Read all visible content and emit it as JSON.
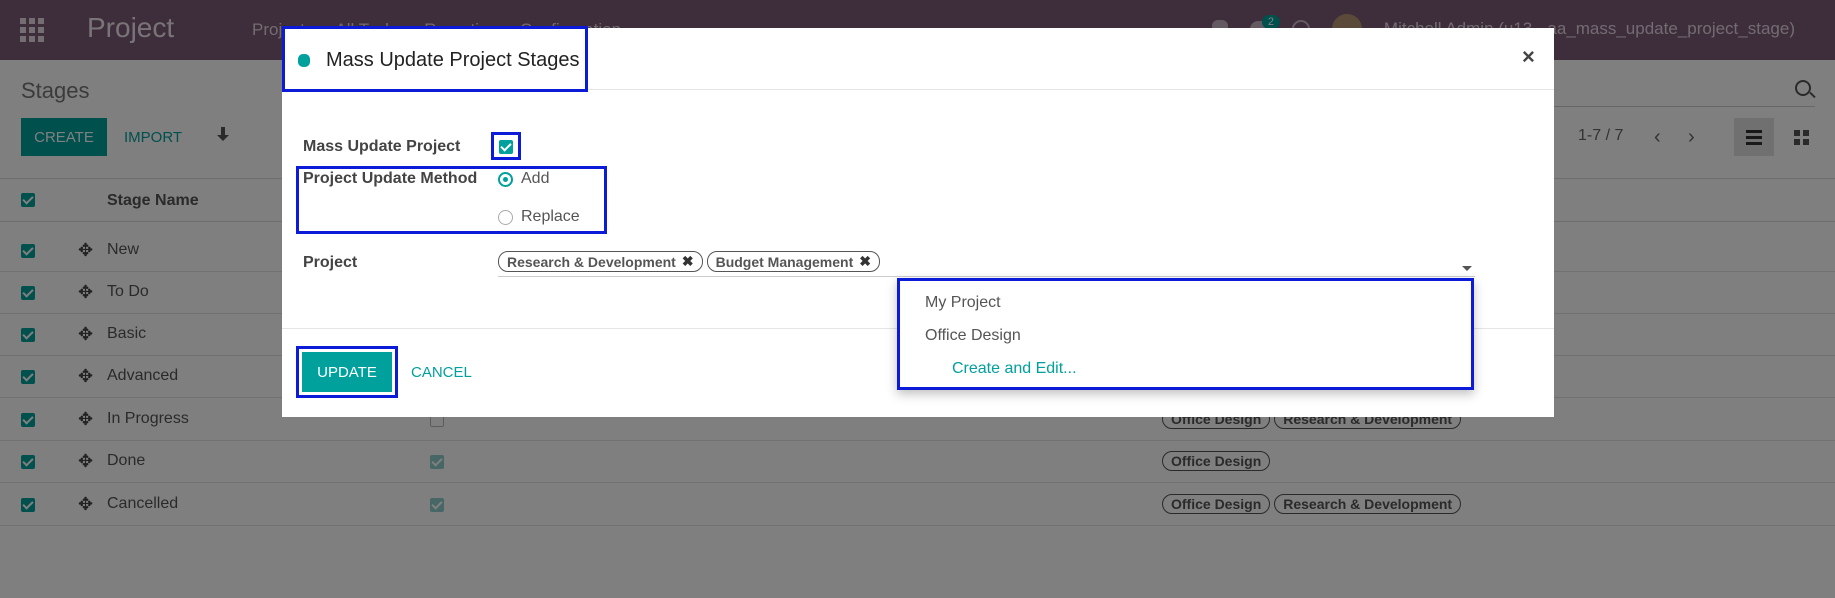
{
  "navbar": {
    "app_name": "Project",
    "menu": [
      "Projects",
      "All Tasks",
      "Reporting",
      "Configuration"
    ],
    "chat_count": "2",
    "user": "Mitchell Admin (u13 - aa_mass_update_project_stage)"
  },
  "control": {
    "breadcrumb": "Stages",
    "create_label": "CREATE",
    "import_label": "IMPORT",
    "pager": "1-7 / 7"
  },
  "list": {
    "column_stage_name": "Stage Name",
    "rows": [
      {
        "name": "New",
        "folded": false,
        "tags": []
      },
      {
        "name": "To Do",
        "folded": false,
        "tags": []
      },
      {
        "name": "Basic",
        "folded": false,
        "tags": []
      },
      {
        "name": "Advanced",
        "folded": false,
        "tags": []
      },
      {
        "name": "In Progress",
        "folded": false,
        "tags": [
          "Office Design",
          "Research & Development"
        ]
      },
      {
        "name": "Done",
        "folded": true,
        "tags": [
          "Office Design"
        ]
      },
      {
        "name": "Cancelled",
        "folded": true,
        "tags": [
          "Office Design",
          "Research & Development"
        ]
      }
    ]
  },
  "modal": {
    "title": "Mass Update Project Stages",
    "close": "×",
    "mass_update_label": "Mass Update Project",
    "mass_update_checked": true,
    "method_label": "Project Update Method",
    "method_options": [
      "Add",
      "Replace"
    ],
    "method_selected": "Add",
    "project_label": "Project",
    "project_tags": [
      "Research & Development",
      "Budget Management"
    ],
    "update_label": "UPDATE",
    "cancel_label": "CANCEL"
  },
  "dropdown": {
    "options": [
      "My Project",
      "Office Design"
    ],
    "create_edit": "Create and Edit..."
  }
}
